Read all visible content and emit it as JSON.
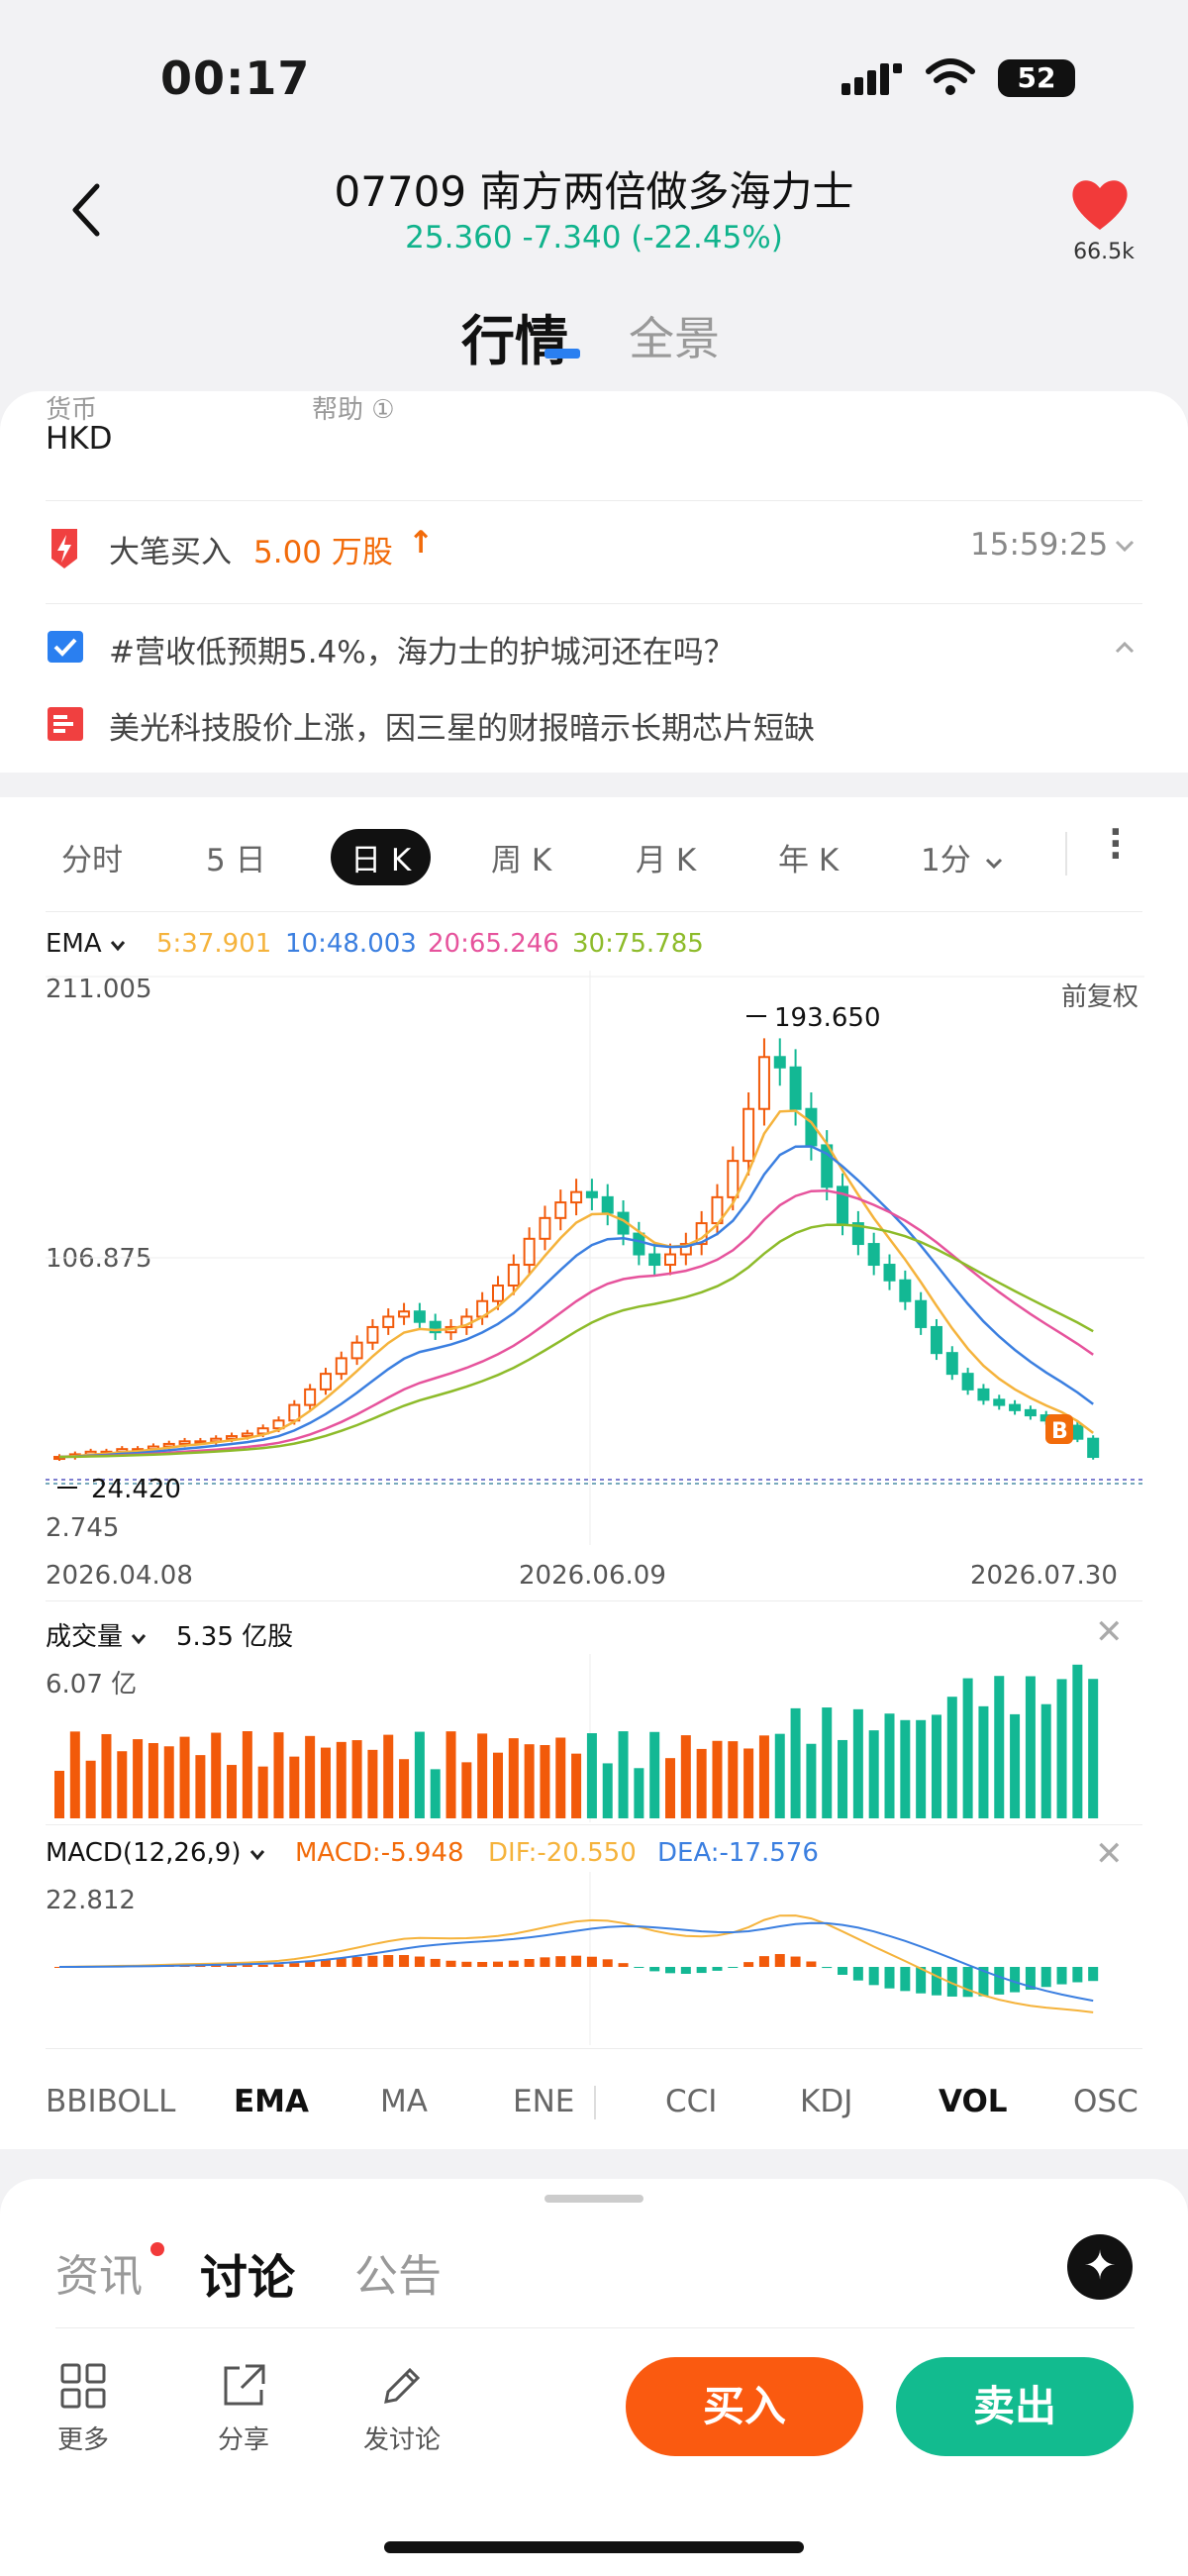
{
  "status_bar": {
    "time": "00:17",
    "battery": "52"
  },
  "header": {
    "title": "07709 南方两倍做多海力士",
    "quote": "25.360 -7.340 (-22.45%)",
    "favorite_count": "66.5k"
  },
  "main_tabs": [
    {
      "label": "行情"
    },
    {
      "label": "全景"
    }
  ],
  "info_card": {
    "partial_labels": [
      "货币",
      "帮助 ①"
    ],
    "currency": "HKD",
    "block_trade": {
      "label": "大笔买入",
      "amount": "5.00 万股",
      "arrow": "↑",
      "time": "15:59:25"
    },
    "news": [
      {
        "text": "#营收低预期5.4%，海力士的护城河还在吗？",
        "icon": "checkbox-icon"
      },
      {
        "text": "美光科技股价上涨，因三星的财报暗示长期芯片短缺",
        "icon": "news-icon"
      }
    ]
  },
  "chart_tabs": [
    "分时",
    "5 日",
    "日 K",
    "周 K",
    "月 K",
    "年 K",
    "1分"
  ],
  "chart_tabs_active": 2,
  "ema_legend": {
    "label": "EMA",
    "items": [
      {
        "text": "5:37.901",
        "color": "#f5b33c"
      },
      {
        "text": "10:48.003",
        "color": "#3b7fe0"
      },
      {
        "text": "20:65.246",
        "color": "#e6539c"
      },
      {
        "text": "30:75.785",
        "color": "#8dbb2a"
      }
    ]
  },
  "price_axis": {
    "max": "211.005",
    "mid": "106.875",
    "min": "2.745",
    "adjust": "前复权",
    "high_mark": "193.650",
    "low_mark": "24.420",
    "badge": "B"
  },
  "date_axis": [
    "2026.04.08",
    "2026.06.09",
    "2026.07.30"
  ],
  "volume": {
    "label": "成交量",
    "value": "5.35 亿股",
    "max": "6.07 亿"
  },
  "macd": {
    "label": "MACD(12,26,9)",
    "macd": "MACD:-5.948",
    "dif": "DIF:-20.550",
    "dea": "DEA:-17.576",
    "max": "22.812"
  },
  "indicator_tabs": [
    "BBIBOLL",
    "EMA",
    "MA",
    "ENE",
    "CCI",
    "KDJ",
    "VOL",
    "OSC"
  ],
  "bottom_tabs": [
    {
      "label": "资讯"
    },
    {
      "label": "讨论"
    },
    {
      "label": "公告"
    }
  ],
  "bottom_tools": [
    {
      "label": "更多"
    },
    {
      "label": "分享"
    },
    {
      "label": "发讨论"
    }
  ],
  "buy_label": "买入",
  "sell_label": "卖出",
  "colors": {
    "up": "#f25a0a",
    "down": "#13b894",
    "accent": "#2a7ff0"
  },
  "chart_data": {
    "type": "candlestick",
    "x_range": [
      "2026.04.08",
      "2026.07.30"
    ],
    "ylim": [
      2.745,
      211.005
    ],
    "high": 193.65,
    "low": 24.42,
    "close": [
      26,
      27,
      28,
      28,
      29,
      29,
      30,
      31,
      32,
      32,
      33,
      34,
      35,
      37,
      40,
      46,
      52,
      58,
      64,
      70,
      76,
      80,
      82,
      78,
      74,
      76,
      80,
      86,
      92,
      100,
      110,
      118,
      124,
      128,
      126,
      120,
      112,
      104,
      100,
      104,
      108,
      116,
      126,
      140,
      160,
      180,
      176,
      160,
      146,
      130,
      116,
      108,
      100,
      94,
      86,
      76,
      66,
      58,
      52,
      48,
      46,
      44,
      42,
      40,
      38,
      33,
      26
    ],
    "ema5_last": 37.901,
    "ema10_last": 48.003,
    "ema20_last": 65.246,
    "ema30_last": 75.785
  }
}
